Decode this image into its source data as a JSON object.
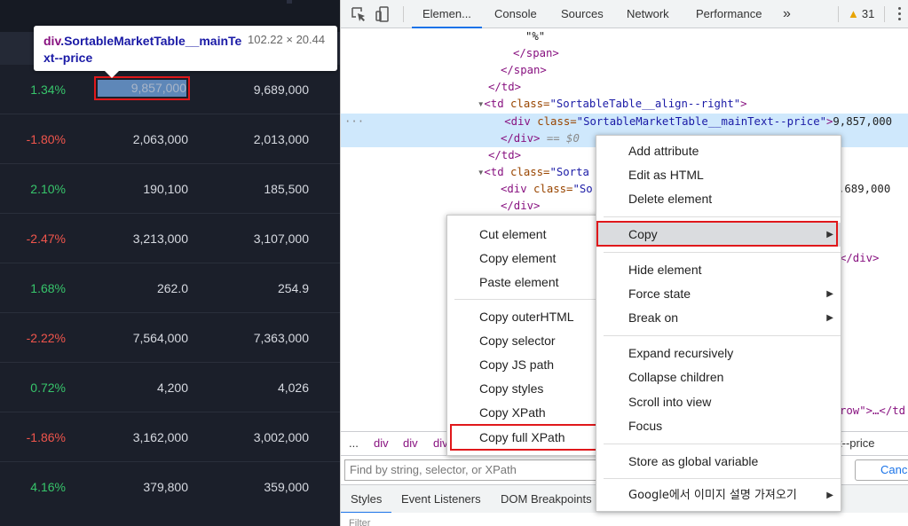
{
  "market": {
    "rows": [
      {
        "change": "1.34%",
        "dir": "pos",
        "price": "9,857,000",
        "prev": "9,689,000"
      },
      {
        "change": "-1.80%",
        "dir": "neg",
        "price": "2,063,000",
        "prev": "2,013,000"
      },
      {
        "change": "2.10%",
        "dir": "pos",
        "price": "190,100",
        "prev": "185,500"
      },
      {
        "change": "-2.47%",
        "dir": "neg",
        "price": "3,213,000",
        "prev": "3,107,000"
      },
      {
        "change": "1.68%",
        "dir": "pos",
        "price": "262.0",
        "prev": "254.9"
      },
      {
        "change": "-2.22%",
        "dir": "neg",
        "price": "7,564,000",
        "prev": "7,363,000"
      },
      {
        "change": "0.72%",
        "dir": "pos",
        "price": "4,200",
        "prev": "4,026"
      },
      {
        "change": "-1.86%",
        "dir": "neg",
        "price": "3,162,000",
        "prev": "3,002,000"
      },
      {
        "change": "4.16%",
        "dir": "pos",
        "price": "379,800",
        "prev": "359,000"
      }
    ],
    "colors": {
      "positive": "#37c56b",
      "negative": "#f0554c",
      "highlight": "#5e87b8"
    }
  },
  "tooltip": {
    "tag": "div",
    "class_name": ".SortableMarketTable__mainText--price",
    "dimensions": "102.22 × 20.44"
  },
  "devtools": {
    "tabs": [
      "Elemen...",
      "Console",
      "Sources",
      "Network",
      "Performance"
    ],
    "more_tabs": "»",
    "warning_count": "31",
    "dom": {
      "l1": "\"%\"",
      "l2": "</span>",
      "l3": "</span>",
      "l4": "</td>",
      "l5_tag": "<td ",
      "l5_attr": "class=",
      "l5_val": "\"SortableTable__align--right\"",
      "l5_end": ">",
      "sel_tag": "<div ",
      "sel_attr": "class=",
      "sel_val": "\"SortableMarketTable__mainText--price\"",
      "sel_end": ">",
      "sel_text": "9,857,000",
      "sel_close": "</div>",
      "sel_eq": " == $0",
      "l8": "</td>",
      "l9_tag": "<td ",
      "l9_attr": "class=",
      "l9_val": "\"Sorta",
      "l10_tag": "<div ",
      "l10_attr": "class=",
      "l10_val": "\"So",
      "l10_right": ",689,000",
      "l11": "</div>",
      "l_div_right": "</div>",
      "l_row_right": "row\">…</td"
    },
    "breadcrumb": [
      "...",
      "div",
      "div",
      "div"
    ],
    "breadcrumb_right": "t--price",
    "find_placeholder": "Find by string, selector, or XPath",
    "cancel_label": "Cance",
    "sub_tabs": [
      "Styles",
      "Event Listeners",
      "DOM Breakpoints"
    ],
    "filter_label": "Filter"
  },
  "main_menu": {
    "items": [
      {
        "label": "Add attribute",
        "submenu": false
      },
      {
        "label": "Edit as HTML",
        "submenu": false
      },
      {
        "label": "Delete element",
        "submenu": false
      },
      {
        "label": "Copy",
        "submenu": true
      },
      {
        "label": "Hide element",
        "submenu": false
      },
      {
        "label": "Force state",
        "submenu": true
      },
      {
        "label": "Break on",
        "submenu": true
      },
      {
        "label": "Expand recursively",
        "submenu": false
      },
      {
        "label": "Collapse children",
        "submenu": false
      },
      {
        "label": "Scroll into view",
        "submenu": false
      },
      {
        "label": "Focus",
        "submenu": false
      },
      {
        "label": "Store as global variable",
        "submenu": false
      },
      {
        "label": "Google에서 이미지 설명 가져오기",
        "submenu": true
      }
    ]
  },
  "copy_menu": {
    "items": [
      {
        "label": "Cut element"
      },
      {
        "label": "Copy element"
      },
      {
        "label": "Paste element"
      },
      {
        "label": "Copy outerHTML"
      },
      {
        "label": "Copy selector"
      },
      {
        "label": "Copy JS path"
      },
      {
        "label": "Copy styles"
      },
      {
        "label": "Copy XPath"
      },
      {
        "label": "Copy full XPath"
      }
    ]
  }
}
